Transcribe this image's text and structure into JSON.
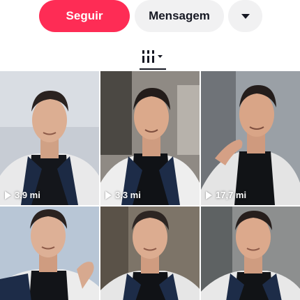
{
  "actions": {
    "follow_label": "Seguir",
    "message_label": "Mensagem",
    "more_icon": "triangle-down-icon"
  },
  "tabs": {
    "videos_icon": "grid-bars-icon"
  },
  "colors": {
    "follow_bg": "#fe2c55",
    "secondary_bg": "#f1f1f2",
    "text_dark": "#161823"
  },
  "videos": [
    {
      "views": "3,9 mi"
    },
    {
      "views": "3,3 mi"
    },
    {
      "views": "17,7 mi"
    },
    {
      "views": ""
    },
    {
      "views": ""
    },
    {
      "views": ""
    }
  ]
}
